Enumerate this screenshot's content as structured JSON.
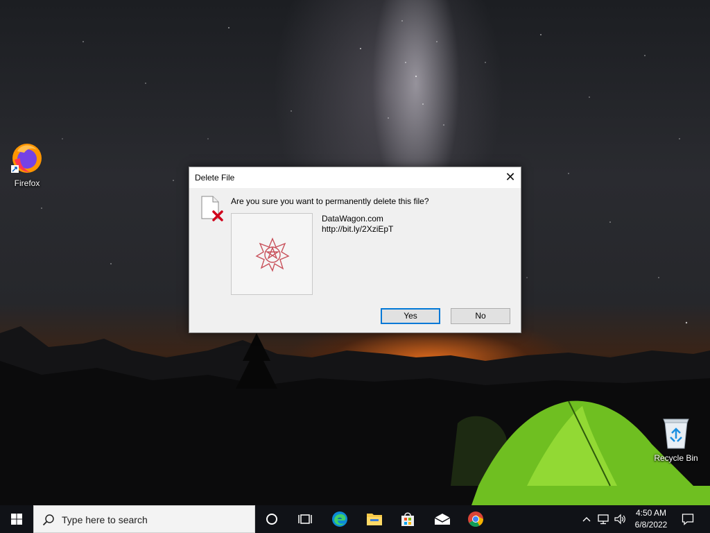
{
  "desktop": {
    "icons": [
      {
        "label": "Firefox"
      },
      {
        "label": "Recycle Bin"
      }
    ]
  },
  "dialog": {
    "title": "Delete File",
    "close_glyph": "✕",
    "question": "Are you sure you want to permanently delete this file?",
    "file_name": "DataWagon.com",
    "file_url": "http://bit.ly/2XziEpT",
    "yes_label": "Yes",
    "no_label": "No",
    "icons": [
      "file-delete-icon",
      "file-thumbnail-icon"
    ]
  },
  "taskbar": {
    "search_placeholder": "Type here to search",
    "pinned": [
      "cortana-icon",
      "task-view-icon",
      "edge-icon",
      "file-explorer-icon",
      "store-icon",
      "mail-icon",
      "chrome-icon"
    ],
    "tray": [
      "chevron-up-icon",
      "network-icon",
      "volume-icon"
    ],
    "time": "4:50 AM",
    "date": "6/8/2022"
  },
  "colors": {
    "accent": "#0078d7",
    "taskbar": "#101217",
    "dialog_bg": "#f0f0f0",
    "delete_x": "#d0021b"
  }
}
